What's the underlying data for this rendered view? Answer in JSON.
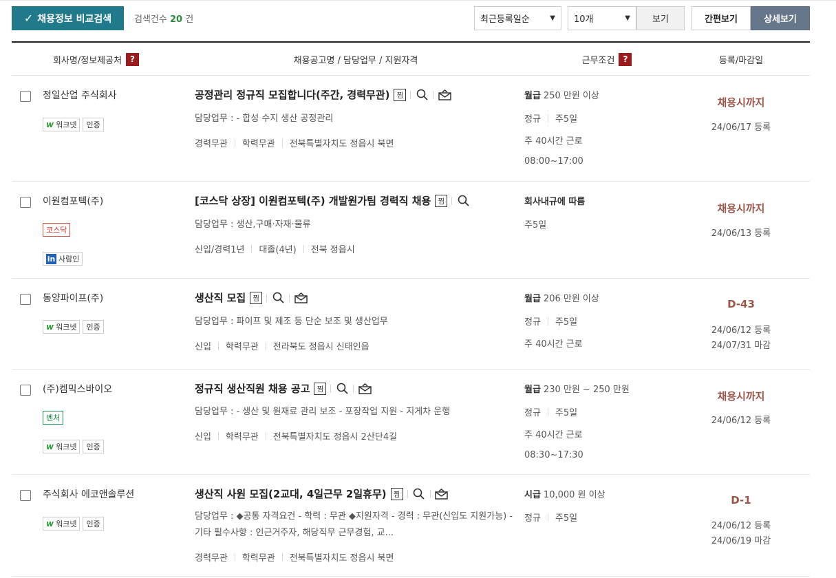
{
  "toolbar": {
    "compare_label": "채용정보 비교검색",
    "count_prefix": "검색건수",
    "count_value": "20",
    "count_suffix": "건",
    "sort_selected": "최근등록일순",
    "per_page_selected": "10개",
    "view_label": "보기",
    "simple_view": "간편보기",
    "detail_view": "상세보기"
  },
  "header": {
    "company": "회사명/정보제공처",
    "title": "채용공고명 / 담당업무 / 지원자격",
    "condition": "근무조건",
    "dates": "등록/마감일",
    "help": "?"
  },
  "colors": {
    "accent": "#217a8c",
    "deadline": "#9a5549",
    "help": "#9b1c1c",
    "active_tab": "#66778b"
  },
  "rows": [
    {
      "company": "정일산업 주식회사",
      "title": "공정관리 정규직 모집합니다(주간, 경력무관)",
      "duty": "담당업무 : - 합성 수지 생산 공정관리",
      "meta": [
        "경력무관",
        "학력무관",
        "전북특별자치도 정읍시 북면"
      ],
      "salary_type": "월급",
      "salary": "250 만원 이상",
      "type": "정규",
      "days": "주5일",
      "hours": "주 40시간 근로",
      "time": "08:00~17:00",
      "deadline": "채용시까지",
      "reg": "24/06/17 등록"
    },
    {
      "company": "이원컴포텍(주)",
      "title": "[코스닥 상장] 이원컴포텍(주) 개발원가팀 경력직 채용",
      "duty": "담당업무 : 생산,구매·자재·물류",
      "meta": [
        "신입/경력1년",
        "대졸(4년)",
        "전북 정읍시"
      ],
      "internal": "회사내규에 따름",
      "days": "주5일",
      "deadline": "채용시까지",
      "reg": "24/06/13 등록",
      "kosdaq": "코스닥",
      "saramin": "사람인"
    },
    {
      "company": "동양파이프(주)",
      "title": "생산직 모집",
      "duty": "담당업무 : 파이프 및 제조 등 단순 보조 및 생산업무",
      "meta": [
        "신입",
        "학력무관",
        "전라북도 정읍시 신태인읍"
      ],
      "salary_type": "월급",
      "salary": "206 만원 이상",
      "type": "정규",
      "days": "주5일",
      "hours": "주 40시간 근로",
      "deadline": "D-43",
      "reg": "24/06/12 등록",
      "close": "24/07/31 마감"
    },
    {
      "company": "(주)켐믹스바이오",
      "title": "정규직 생산직원 채용 공고",
      "duty": "담당업무 : - 생산 및 원재료 관리 보조 - 포장작업 지원 - 지게차 운행",
      "meta": [
        "신입",
        "학력무관",
        "전북특별자치도 정읍시 2산단4길"
      ],
      "salary_type": "월급",
      "salary": "230 만원 ~ 250 만원",
      "type": "정규",
      "days": "주5일",
      "hours": "주 40시간 근로",
      "time": "08:30~17:30",
      "deadline": "채용시까지",
      "reg": "24/06/12 등록",
      "venture": "벤처"
    },
    {
      "company": "주식회사 에코앤솔루션",
      "title": "생산직 사원 모집(2교대, 4일근무 2일휴무)",
      "duty": "담당업무 : ◆공통 자격요건 - 학력 : 무관 ◆지원자격 - 경력 : 무관(신입도 지원가능) - 기타 필수사항 : 인근거주자, 해당직무 근무경험, 교...",
      "meta": [
        "경력무관",
        "학력무관",
        "전북특별자치도 정읍시 북면"
      ],
      "salary_type": "시급",
      "salary": "10,000 원 이상",
      "type": "정규",
      "days": "주5일",
      "deadline": "D-1",
      "reg": "24/06/12 등록",
      "close": "24/06/19 마감"
    }
  ],
  "badges": {
    "worknet": "워크넷",
    "cert": "인증",
    "jjim": "찜"
  }
}
